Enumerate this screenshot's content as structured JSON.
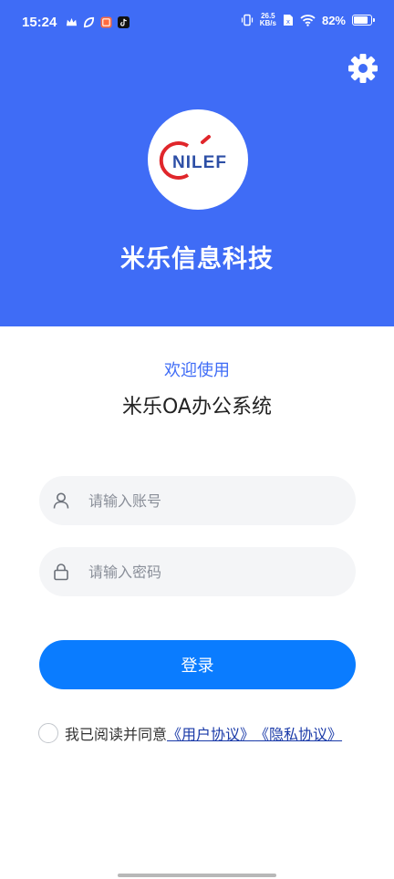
{
  "status_bar": {
    "time": "15:24",
    "net_speed_value": "26.5",
    "net_speed_unit": "KB/s",
    "battery_percent": "82%",
    "battery_level": 0.82,
    "app_icons": [
      "crown-icon",
      "leaf-icon",
      "app-badge-icon",
      "tiktok-icon"
    ]
  },
  "header": {
    "company_name": "米乐信息科技",
    "logo_text": "NILEF",
    "background_color": "#3f6cf6"
  },
  "main": {
    "welcome": "欢迎使用",
    "system_name": "米乐OA办公系统"
  },
  "form": {
    "account_placeholder": "请输入账号",
    "password_placeholder": "请输入密码",
    "login_label": "登录"
  },
  "agreement": {
    "prefix": "我已阅读并同意",
    "user_agreement": "《用户协议》",
    "privacy_policy": "《隐私协议》"
  },
  "colors": {
    "accent": "#3f6cf6",
    "button": "#0a7cff",
    "link": "#1a3aa8",
    "input_bg": "#f4f5f7"
  }
}
